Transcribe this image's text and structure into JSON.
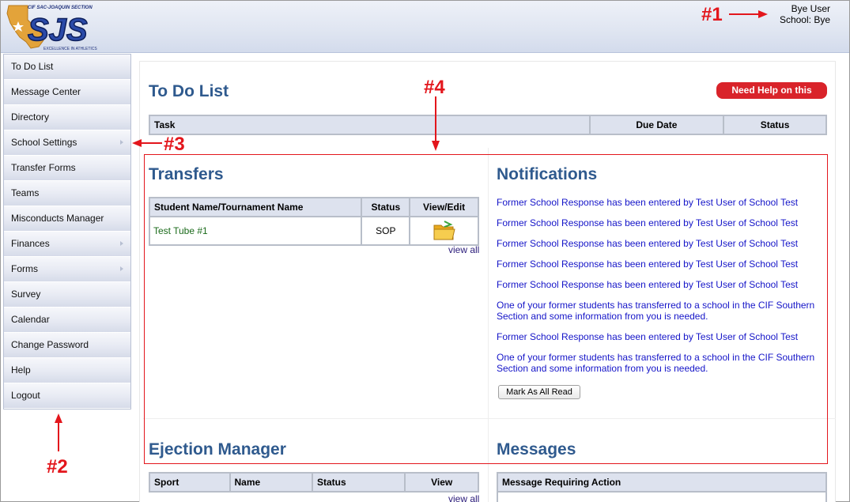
{
  "header": {
    "logo_top_text": "CIF SAC-JOAQUIN SECTION",
    "logo_letters": "SJS",
    "logo_tagline": "EXCELLENCE IN ATHLETICS",
    "user_name": "Bye User",
    "school": "School: Bye"
  },
  "sidebar": {
    "items": [
      {
        "label": "To Do List",
        "has_submenu": false
      },
      {
        "label": "Message Center",
        "has_submenu": false
      },
      {
        "label": "Directory",
        "has_submenu": false
      },
      {
        "label": "School Settings",
        "has_submenu": true
      },
      {
        "label": "Transfer Forms",
        "has_submenu": false
      },
      {
        "label": "Teams",
        "has_submenu": false
      },
      {
        "label": "Misconducts Manager",
        "has_submenu": false
      },
      {
        "label": "Finances",
        "has_submenu": true
      },
      {
        "label": "Forms",
        "has_submenu": true
      },
      {
        "label": "Survey",
        "has_submenu": false
      },
      {
        "label": "Calendar",
        "has_submenu": false
      },
      {
        "label": "Change Password",
        "has_submenu": false
      },
      {
        "label": "Help",
        "has_submenu": false
      },
      {
        "label": "Logout",
        "has_submenu": false
      }
    ]
  },
  "todo": {
    "title": "To Do List",
    "help_button": "Need Help on this Page?",
    "columns": [
      "Task",
      "Due Date",
      "Status"
    ]
  },
  "transfers": {
    "title": "Transfers",
    "columns": [
      "Student Name/Tournament Name",
      "Status",
      "View/Edit"
    ],
    "rows": [
      {
        "name": "Test Tube #1",
        "status": "SOP",
        "icon": "folder-icon"
      }
    ],
    "view_all": "view all"
  },
  "notifications": {
    "title": "Notifications",
    "items": [
      "Former School Response has been entered by Test User of School Test",
      "Former School Response has been entered by Test User of School Test",
      "Former School Response has been entered by Test User of School Test",
      "Former School Response has been entered by Test User of School Test",
      "Former School Response has been entered by Test User of School Test",
      "One of your former students has transferred to a school in the CIF Southern Section and some information from you is needed.",
      "Former School Response has been entered by Test User of School Test",
      "One of your former students has transferred to a school in the CIF Southern Section and some information from you is needed."
    ],
    "mark_all_read": "Mark As All Read"
  },
  "ejection": {
    "title": "Ejection Manager",
    "columns": [
      "Sport",
      "Name",
      "Status",
      "View"
    ],
    "view_all": "view all"
  },
  "messages": {
    "title": "Messages",
    "columns": [
      "Message Requiring Action"
    ]
  },
  "annotations": {
    "a1": "#1",
    "a2": "#2",
    "a3": "#3",
    "a4": "#4"
  },
  "colors": {
    "accent_title": "#2f5a8e",
    "help_red": "#d9232a",
    "annotation_red": "#e3161c",
    "link_blue": "#1515c8",
    "transfer_name_green": "#1a6a1a"
  }
}
